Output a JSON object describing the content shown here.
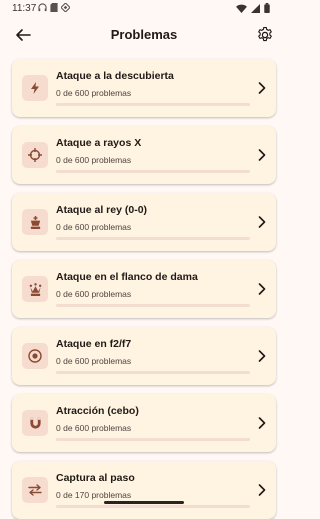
{
  "status": {
    "time": "11:37",
    "icons": [
      "headset-icon",
      "sd-card-icon",
      "diamond-icon",
      "wifi-icon",
      "signal-icon",
      "battery-icon"
    ]
  },
  "app_bar": {
    "title": "Problemas",
    "back_icon": "arrow-back-icon",
    "settings_icon": "gear-icon"
  },
  "colors": {
    "background": "#FFF8F5",
    "card": "#FFF3E2",
    "icon_box": "#F6DCCF",
    "icon": "#8A4A33",
    "progress_track": "#F3DCD0"
  },
  "problems": [
    {
      "title": "Ataque a la descubierta",
      "subtitle": "0 de 600 problemas",
      "icon": "lightning-icon",
      "progress": 0
    },
    {
      "title": "Ataque a rayos X",
      "subtitle": "0 de 600 problemas",
      "icon": "crosshair-icon",
      "progress": 0
    },
    {
      "title": "Ataque al rey (0-0)",
      "subtitle": "0 de 600 problemas",
      "icon": "chess-king-icon",
      "progress": 0
    },
    {
      "title": "Ataque en el flanco de dama",
      "subtitle": "0 de 600 problemas",
      "icon": "chess-queen-icon",
      "progress": 0
    },
    {
      "title": "Ataque en f2/f7",
      "subtitle": "0 de 600 problemas",
      "icon": "target-icon",
      "progress": 0
    },
    {
      "title": "Atracción (cebo)",
      "subtitle": "0 de 600 problemas",
      "icon": "magnet-icon",
      "progress": 0
    },
    {
      "title": "Captura al paso",
      "subtitle": "0 de 170 problemas",
      "icon": "swap-icon",
      "progress": 0
    }
  ]
}
